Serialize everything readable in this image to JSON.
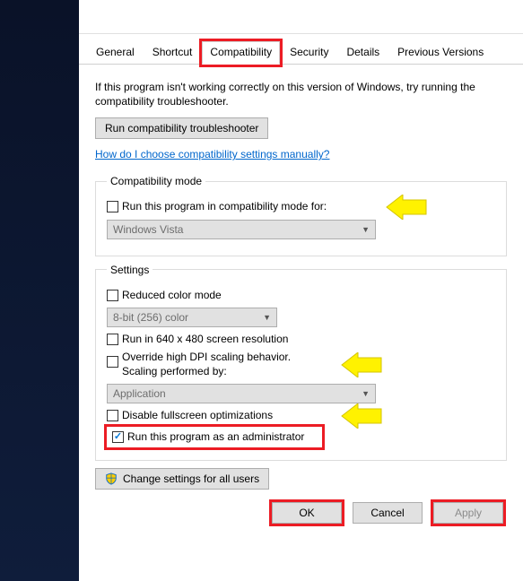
{
  "tabs": {
    "general": "General",
    "shortcut": "Shortcut",
    "compatibility": "Compatibility",
    "security": "Security",
    "details": "Details",
    "previous": "Previous Versions"
  },
  "intro": "If this program isn't working correctly on this version of Windows, try running the compatibility troubleshooter.",
  "troubleshoot_button": "Run compatibility troubleshooter",
  "help_link": "How do I choose compatibility settings manually?",
  "compat_mode": {
    "legend": "Compatibility mode",
    "checkbox_label": "Run this program in compatibility mode for:",
    "combo_value": "Windows Vista"
  },
  "settings": {
    "legend": "Settings",
    "reduced_color": "Reduced color mode",
    "color_combo": "8-bit (256) color",
    "res_640": "Run in 640 x 480 screen resolution",
    "dpi_override": "Override high DPI scaling behavior.\nScaling performed by:",
    "dpi_combo": "Application",
    "disable_fullscreen": "Disable fullscreen optimizations",
    "run_admin": "Run this program as an administrator"
  },
  "change_all_users": "Change settings for all users",
  "buttons": {
    "ok": "OK",
    "cancel": "Cancel",
    "apply": "Apply"
  }
}
